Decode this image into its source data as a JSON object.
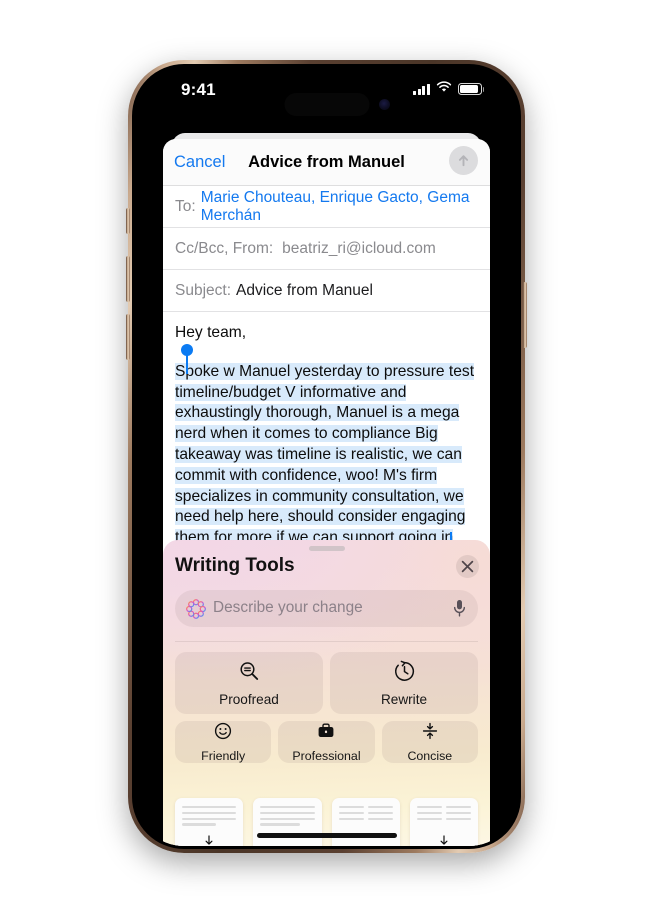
{
  "device": {
    "status_bar": {
      "time": "9:41",
      "cellular_icon": "cellular-bars-icon",
      "wifi_icon": "wifi-icon",
      "battery_icon": "battery-icon"
    },
    "home_indicator": "home-indicator"
  },
  "mail": {
    "cancel_label": "Cancel",
    "title": "Advice from Manuel",
    "send_icon": "send-arrow-up-icon",
    "fields": {
      "to_label": "To:",
      "to_value": "Marie Chouteau, Enrique Gacto, Gema Merchán",
      "ccbcc_label": "Cc/Bcc, From:",
      "from_value": "beatriz_ri@icloud.com",
      "subject_label": "Subject:",
      "subject_value": "Advice from Manuel"
    },
    "body": {
      "greeting": "Hey team,",
      "selected_text": "Spoke w Manuel yesterday to pressure test timeline/budget\nV informative and exhaustingly thorough, Manuel is a mega nerd when it comes to compliance\nBig takeaway was timeline is realistic, we can commit with confidence, woo!\nM's firm specializes in community consultation, we need help here, should consider engaging them for more if we can support going in"
    }
  },
  "writing_tools": {
    "title": "Writing Tools",
    "close_icon": "close-x-icon",
    "input": {
      "placeholder": "Describe your change",
      "leading_icon": "apple-intelligence-icon",
      "trailing_icon": "microphone-icon"
    },
    "primary_actions": [
      {
        "label": "Proofread",
        "icon": "proofread-magnifier-icon"
      },
      {
        "label": "Rewrite",
        "icon": "rewrite-clock-arrow-icon"
      }
    ],
    "tone_actions": [
      {
        "label": "Friendly",
        "icon": "smiley-face-icon"
      },
      {
        "label": "Professional",
        "icon": "briefcase-icon"
      },
      {
        "label": "Concise",
        "icon": "compress-arrows-icon"
      }
    ],
    "suggestion_cards": [
      {
        "style": "lines",
        "arrow_icon": "download-arrow-icon"
      },
      {
        "style": "lines",
        "arrow_icon": ""
      },
      {
        "style": "columns",
        "arrow_icon": ""
      },
      {
        "style": "columns",
        "arrow_icon": "download-arrow-icon"
      }
    ]
  },
  "colors": {
    "accent_blue": "#1479ef",
    "selection_blue": "#d8eafb",
    "panel_top": "#f0dbe6",
    "panel_bottom": "#fdf7e4",
    "frame_gold": "#c9a98d"
  }
}
